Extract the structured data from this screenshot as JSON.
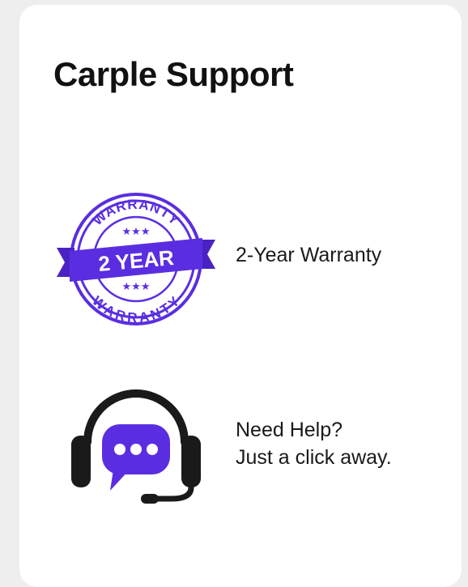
{
  "title": "Carple Support",
  "brand_color": "#5a2ee0",
  "features": [
    {
      "icon": "warranty-badge-icon",
      "badge_text": {
        "top_arc": "WARRANTY",
        "ribbon": "2 YEAR",
        "bottom_arc": "WARRANTY",
        "stars": "★★★"
      },
      "label": "2-Year Warranty"
    },
    {
      "icon": "headset-chat-icon",
      "label_line1": "Need Help?",
      "label_line2": "Just a click away."
    }
  ]
}
